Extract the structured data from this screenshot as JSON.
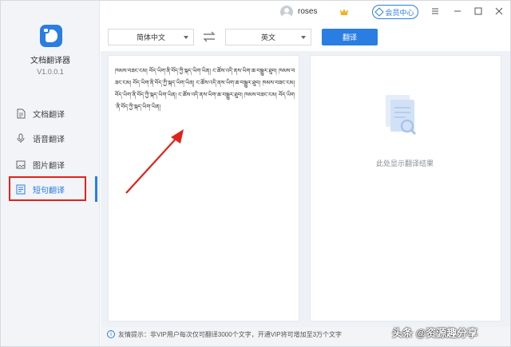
{
  "app": {
    "name": "文档翻译器",
    "version": "V1.0.0.1"
  },
  "nav": [
    {
      "label": "文档翻译",
      "icon": "document-icon",
      "active": false
    },
    {
      "label": "语音翻译",
      "icon": "microphone-icon",
      "active": false
    },
    {
      "label": "图片翻译",
      "icon": "image-icon",
      "active": false
    },
    {
      "label": "短句翻译",
      "icon": "sentence-icon",
      "active": true
    }
  ],
  "titlebar": {
    "username": "roses",
    "member_label": "会员中心"
  },
  "toolbar": {
    "source_lang": "简体中文",
    "target_lang": "英文",
    "translate_label": "翻译"
  },
  "source_text": "ཁམས་བཟང་ངམ། བོད་ཡིག་ནི་བོད་ཀྱི་སྐད་ཡིག་ཡིན། ང་ཚོས་འདི་ནས་ཡིག་ཆ་བསྒྱུར་ཐུབ། ཁམས་བཟང་ངམ། བོད་ཡིག་ནི་བོད་ཀྱི་སྐད་ཡིག་ཡིན། ང་ཚོས་འདི་ནས་ཡིག་ཆ་བསྒྱུར་ཐུབ། ཁམས་བཟང་ངམ། བོད་ཡིག་ནི་བོད་ཀྱི་སྐད་ཡིག་ཡིན། ང་ཚོས་འདི་ནས་ཡིག་ཆ་བསྒྱུར་ཐུབ། ཁམས་བཟང་ངམ། བོད་ཡིག་ནི་བོད་ཀྱི་སྐད་ཡིག་ཡིན།",
  "result": {
    "placeholder": "此处显示翻译结果"
  },
  "footer": {
    "tip": "友情提示：非VIP用户每次仅可翻译3000个文字，开通VIP将可增加至3万个文字"
  },
  "watermark": "头条 @资源趣分享",
  "colors": {
    "accent": "#2a7de1",
    "highlight": "#e0231a"
  }
}
